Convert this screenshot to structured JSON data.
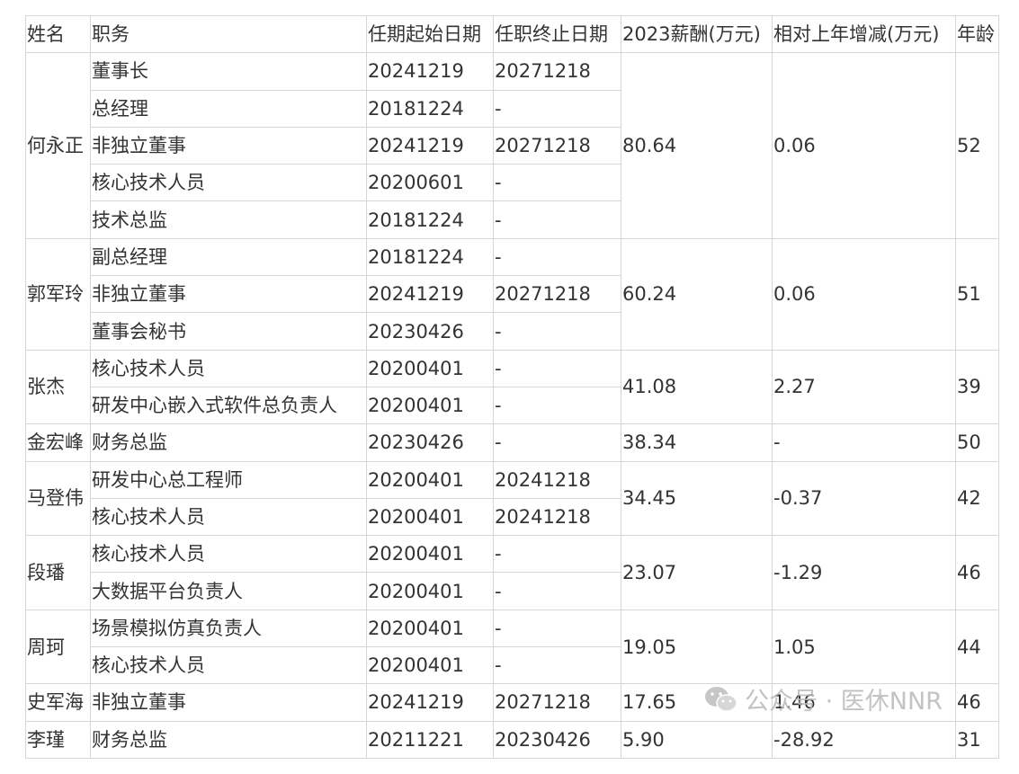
{
  "headers": [
    "姓名",
    "职务",
    "任期起始日期",
    "任职终止日期",
    "2023薪酬(万元)",
    "相对上年增减(万元)",
    "年龄"
  ],
  "people": [
    {
      "name": "何永正",
      "salary": "80.64",
      "change": "0.06",
      "age": "52",
      "roles": [
        {
          "title": "董事长",
          "start": "20241219",
          "end": "20271218"
        },
        {
          "title": "总经理",
          "start": "20181224",
          "end": "-"
        },
        {
          "title": "非独立董事",
          "start": "20241219",
          "end": "20271218"
        },
        {
          "title": "核心技术人员",
          "start": "20200601",
          "end": "-"
        },
        {
          "title": "技术总监",
          "start": "20181224",
          "end": "-"
        }
      ]
    },
    {
      "name": "郭军玲",
      "salary": "60.24",
      "change": "0.06",
      "age": "51",
      "roles": [
        {
          "title": "副总经理",
          "start": "20181224",
          "end": "-"
        },
        {
          "title": "非独立董事",
          "start": "20241219",
          "end": "20271218"
        },
        {
          "title": "董事会秘书",
          "start": "20230426",
          "end": "-"
        }
      ]
    },
    {
      "name": "张杰",
      "salary": "41.08",
      "change": "2.27",
      "age": "39",
      "roles": [
        {
          "title": "核心技术人员",
          "start": "20200401",
          "end": "-"
        },
        {
          "title": "研发中心嵌入式软件总负责人",
          "start": "20200401",
          "end": "-"
        }
      ]
    },
    {
      "name": "金宏峰",
      "salary": "38.34",
      "change": "-",
      "age": "50",
      "roles": [
        {
          "title": "财务总监",
          "start": "20230426",
          "end": "-"
        }
      ]
    },
    {
      "name": "马登伟",
      "salary": "34.45",
      "change": "-0.37",
      "age": "42",
      "roles": [
        {
          "title": "研发中心总工程师",
          "start": "20200401",
          "end": "20241218"
        },
        {
          "title": "核心技术人员",
          "start": "20200401",
          "end": "20241218"
        }
      ]
    },
    {
      "name": "段璠",
      "salary": "23.07",
      "change": "-1.29",
      "age": "46",
      "roles": [
        {
          "title": "核心技术人员",
          "start": "20200401",
          "end": "-"
        },
        {
          "title": "大数据平台负责人",
          "start": "20200401",
          "end": "-"
        }
      ]
    },
    {
      "name": "周珂",
      "salary": "19.05",
      "change": "1.05",
      "age": "44",
      "roles": [
        {
          "title": "场景模拟仿真负责人",
          "start": "20200401",
          "end": "-"
        },
        {
          "title": "核心技术人员",
          "start": "20200401",
          "end": "-"
        }
      ]
    },
    {
      "name": "史军海",
      "salary": "17.65",
      "change": "1.46",
      "age": "46",
      "roles": [
        {
          "title": "非独立董事",
          "start": "20241219",
          "end": "20271218"
        }
      ]
    },
    {
      "name": "李瑾",
      "salary": "5.90",
      "change": "-28.92",
      "age": "31",
      "roles": [
        {
          "title": "财务总监",
          "start": "20211221",
          "end": "20230426"
        }
      ]
    }
  ],
  "watermark": {
    "text": "公众号 · 医休NNR",
    "icon": "wechat-icon"
  }
}
